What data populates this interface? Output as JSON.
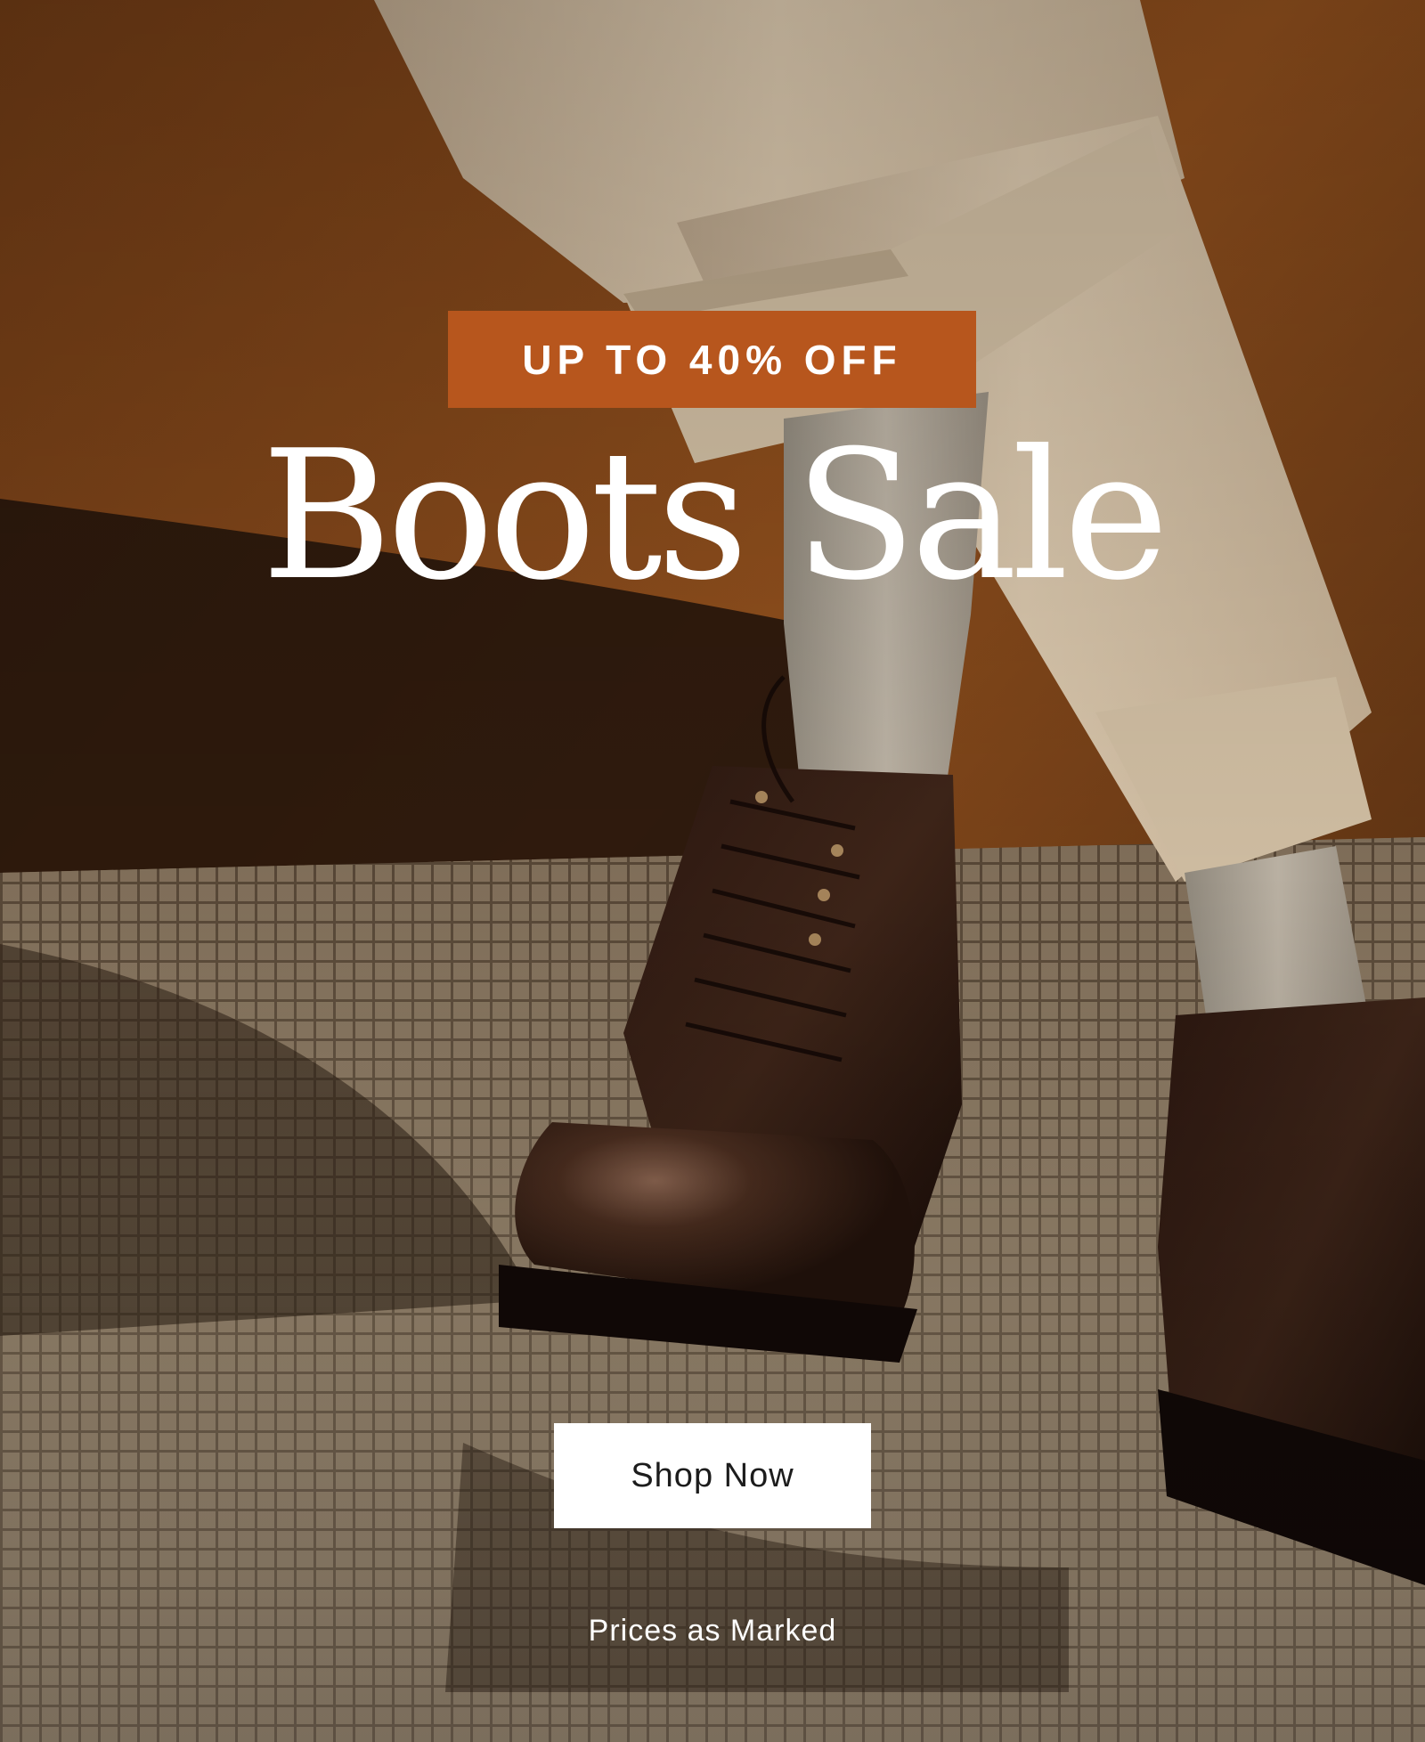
{
  "hero": {
    "badge_text": "UP TO 40% OFF",
    "headline": "Boots Sale",
    "cta_label": "Shop Now",
    "footnote": "Prices as Marked"
  },
  "colors": {
    "badge_background": "#b7561d",
    "cta_background": "#ffffff",
    "text_on_image": "#ffffff"
  },
  "background_image": {
    "subject": "brown leather lace-up cap-toe boots, cream cuffed trousers, ribbed grey socks, leather chair, tiled floor"
  }
}
